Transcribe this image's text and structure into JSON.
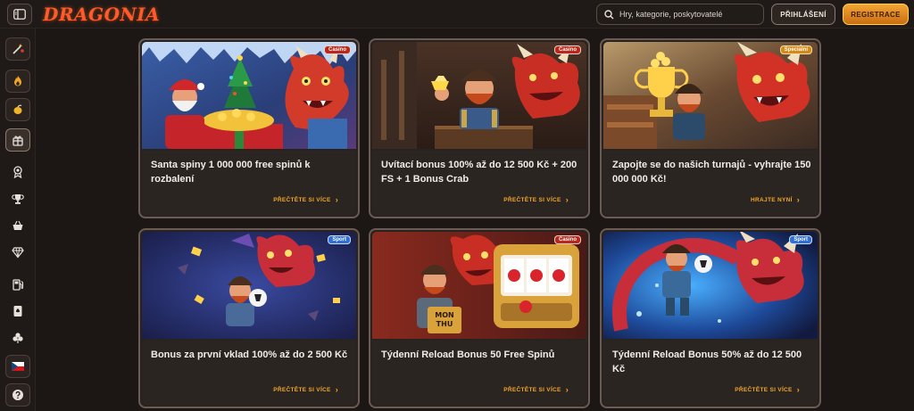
{
  "header": {
    "logo_text": "DRAGONIA",
    "search_placeholder": "Hry, kategorie, poskytovatelé",
    "login_label": "PŘIHLÁŠENÍ",
    "register_label": "REGISTRACE"
  },
  "sidebar": {
    "items": [
      {
        "icon": "magic-wand-icon"
      },
      {
        "icon": "fire-icon"
      },
      {
        "icon": "lemon-icon"
      },
      {
        "icon": "gift-icon"
      },
      {
        "icon": "award-icon"
      },
      {
        "icon": "trophy-icon"
      },
      {
        "icon": "basket-icon"
      },
      {
        "icon": "diamond-icon"
      },
      {
        "icon": "fuel-icon"
      },
      {
        "icon": "card-icon"
      },
      {
        "icon": "clover-icon"
      },
      {
        "icon": "czech-flag-icon"
      },
      {
        "icon": "help-icon"
      }
    ]
  },
  "promotions": [
    {
      "badge": "Casino",
      "title": "Santa spiny 1 000 000 free spinů k rozbalení",
      "link": "PŘEČTĚTE SI VÍCE"
    },
    {
      "badge": "Casino",
      "title": "Uvítací bonus 100% až do 12 500 Kč + 200 FS + 1 Bonus Crab",
      "link": "PŘEČTĚTE SI VÍCE"
    },
    {
      "badge": "Specialní",
      "title": "Zapojte se do našich turnajů - vyhrajte 150 000 000 Kč!",
      "link": "HRAJTE NYNÍ"
    },
    {
      "badge": "Sport",
      "title": "Bonus za první vklad 100% až do 2 500 Kč",
      "link": "PŘEČTĚTE SI VÍCE"
    },
    {
      "badge": "Casino",
      "title": "Týdenní Reload Bonus 50 Free Spinů",
      "link": "PŘEČTĚTE SI VÍCE"
    },
    {
      "badge": "Sport",
      "title": "Týdenní Reload Bonus 50% až do 12 500 Kč",
      "link": "PŘEČTĚTE SI VÍCE"
    }
  ],
  "card_art": {
    "c2_sign_line1": "MON",
    "c2_sign_line2": "THU"
  },
  "colors": {
    "accent": "#f0a62a",
    "background": "#1c1715",
    "casino_badge": "#b8281b",
    "special_badge": "#d48a18",
    "sport_badge": "#2f6fd6"
  }
}
